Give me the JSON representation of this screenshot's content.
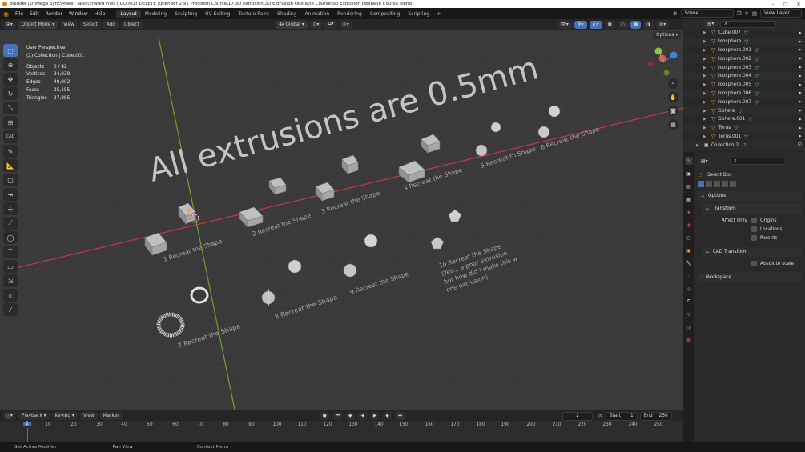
{
  "window": {
    "title": "Blender [D:\\Mega Sync\\Maker Tales\\Shared Files ( DO NOT DELETE )\\Blender 2.91 Precision Course\\17 3D extrusion\\3D Extrusion Obstacle Course\\3D Extrusion Obstacle Course.blend]",
    "controls": [
      "–",
      "□",
      "✕"
    ]
  },
  "menu": [
    "File",
    "Edit",
    "Render",
    "Window",
    "Help"
  ],
  "workspaces": [
    "Layout",
    "Modeling",
    "Sculpting",
    "UV Editing",
    "Texture Paint",
    "Shading",
    "Animation",
    "Rendering",
    "Compositing",
    "Scripting"
  ],
  "active_workspace": "Layout",
  "workspace_add": "+",
  "scene_field": "Scene",
  "viewlayer_field": "View Layer",
  "viewport_header": {
    "mode": "Object Mode",
    "menus": [
      "View",
      "Select",
      "Add",
      "Object"
    ],
    "orientation": "Global",
    "options": "Options"
  },
  "viewport": {
    "perspective": "User Perspective",
    "collection": "(2) Collection | Cube.001",
    "stats": [
      {
        "k": "Objects",
        "v": "0 / 42"
      },
      {
        "k": "Vertices",
        "v": "24,939"
      },
      {
        "k": "Edges",
        "v": "49,902"
      },
      {
        "k": "Faces",
        "v": "25,155"
      },
      {
        "k": "Triangles",
        "v": "27,885"
      }
    ],
    "big_text": "All extrusions are 0.5mm",
    "labels": [
      "1 Recreat the Shape",
      "2 Recreat the Shape",
      "3 Recreat the Shape",
      "4 Recreat the Shape",
      "5 Recreat th Shape",
      "6 Recreat the Shape",
      "7 Recreat the Shape",
      "8 Recreat the Shape",
      "9 Recreat the Shape",
      "10 Recreat the Shape",
      "(Yes... a poor extrusion",
      "but how did I make this w",
      "one extrusion)"
    ],
    "gizmo_axes": {
      "x": "#e84c5a",
      "y": "#8cc63e",
      "z": "#3c80e0"
    }
  },
  "toolbar_tools": [
    "select-box",
    "cursor",
    "move",
    "rotate",
    "scale",
    "transform",
    "cad",
    "annotate",
    "measure",
    "add-cube",
    "extrude",
    "inset",
    "bevel",
    "loop-cut",
    "knife",
    "poly-build",
    "spin",
    "smooth",
    "edge-slide",
    "shrink",
    "shear",
    "rip"
  ],
  "timeline": {
    "menus": [
      "Playback",
      "Keying",
      "View",
      "Marker"
    ],
    "current_frame": "2",
    "start_label": "Start",
    "start": "1",
    "end_label": "End",
    "end": "250",
    "ticks": [
      "10",
      "20",
      "30",
      "40",
      "50",
      "60",
      "70",
      "80",
      "90",
      "100",
      "110",
      "120",
      "130",
      "140",
      "150",
      "160",
      "170",
      "180",
      "190",
      "200",
      "210",
      "220",
      "230",
      "240",
      "250"
    ],
    "playhead": "2"
  },
  "statusbar": [
    "Set Active Modifier",
    "Pan View",
    "Context Menu"
  ],
  "outliner": {
    "rows": [
      {
        "name": "Cube.007"
      },
      {
        "name": "Icosphere"
      },
      {
        "name": "Icosphere.001"
      },
      {
        "name": "Icosphere.002"
      },
      {
        "name": "Icosphere.003"
      },
      {
        "name": "Icosphere.004"
      },
      {
        "name": "Icosphere.005"
      },
      {
        "name": "Icosphere.006"
      },
      {
        "name": "Icosphere.007"
      },
      {
        "name": "Sphere"
      },
      {
        "name": "Sphere.001"
      },
      {
        "name": "Torus"
      },
      {
        "name": "Torus.001"
      }
    ],
    "collection2": "Collection 2",
    "collection2_count": "2"
  },
  "properties": {
    "tool": "Select Box",
    "options_panel": "Options",
    "transform_panel": "Transform",
    "affect_only": "Affect Only",
    "checkboxes": [
      "Origins",
      "Locations",
      "Parents"
    ],
    "cad_panel": "CAD Transform",
    "absolute_scale": "Absolute scale",
    "workspace_panel": "Workspace"
  }
}
